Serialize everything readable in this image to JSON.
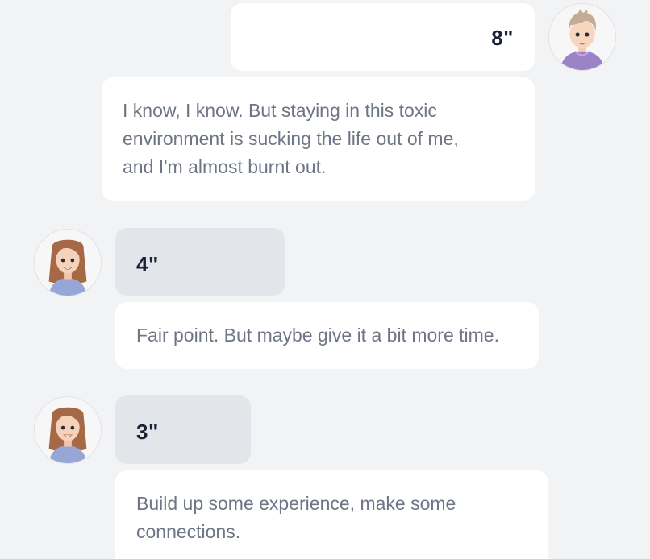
{
  "messages": [
    {
      "sender": "self",
      "avatar_icon": "male-avatar-icon",
      "voice_duration": "8\"",
      "text": "I know, I know. But staying in this toxic environment is sucking the life out of me, and I'm almost burnt out."
    },
    {
      "sender": "other",
      "avatar_icon": "female-avatar-icon",
      "voice_duration": "4\"",
      "text": "Fair point. But maybe give it a bit more time."
    },
    {
      "sender": "other",
      "avatar_icon": "female-avatar-icon",
      "voice_duration": "3\"",
      "text": "Build up some experience, make some connections."
    }
  ],
  "colors": {
    "background": "#f2f3f5",
    "self_bubble": "#ffffff",
    "other_voice_bubble": "#e2e5ea",
    "duration_text": "#1c2236",
    "message_text": "#6e7585"
  }
}
